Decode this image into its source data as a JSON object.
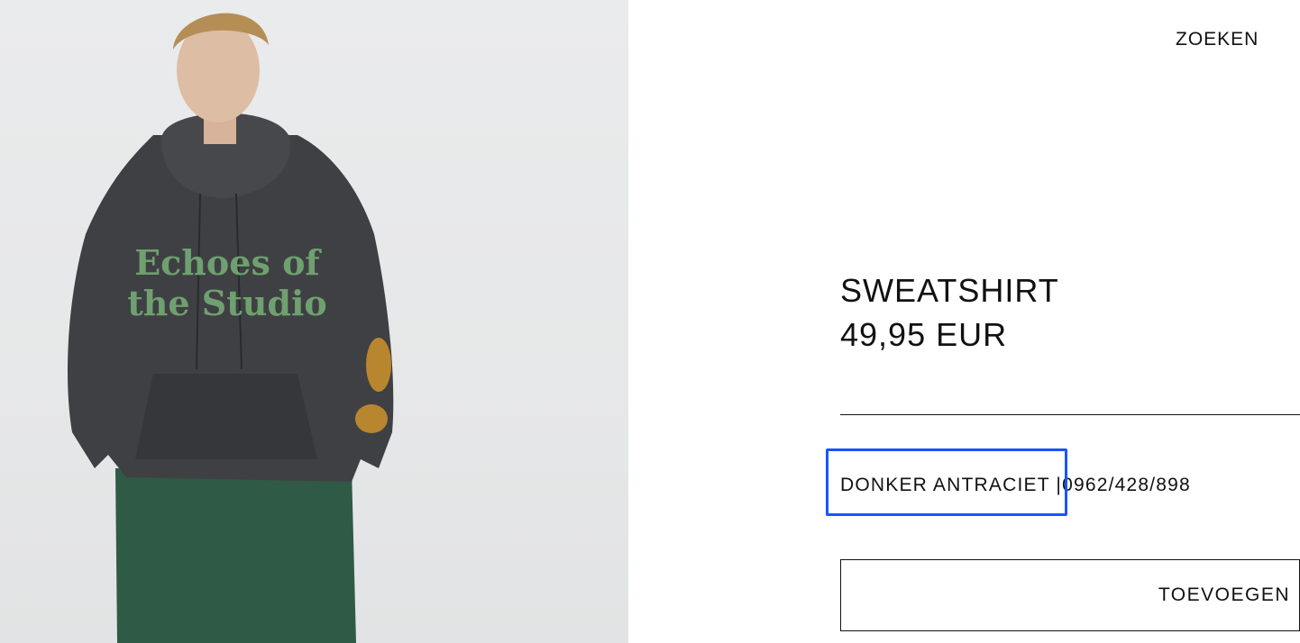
{
  "header": {
    "search_label": "ZOEKEN"
  },
  "product": {
    "name": "SWEATSHIRT",
    "price": "49,95 EUR",
    "color": "DONKER ANTRACIET",
    "separator": "|",
    "reference": "0962/428/898",
    "add_label": "TOEVOEGEN",
    "print_text_line1": "Echoes of",
    "print_text_line2": "the Studio"
  },
  "colors": {
    "highlight": "#1457ff",
    "hoodie": "#3f4043",
    "print": "#6fa06f",
    "pants": "#2f5a46"
  }
}
